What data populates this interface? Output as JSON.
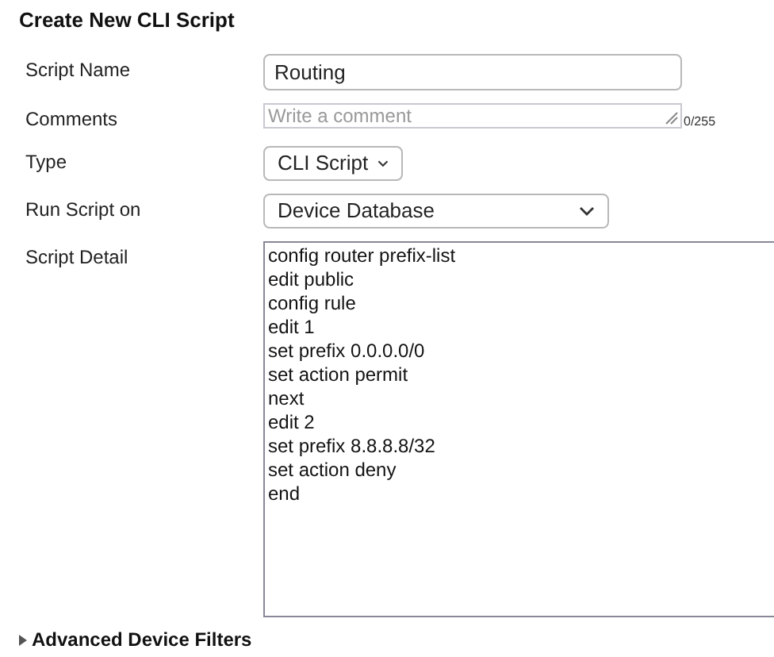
{
  "title": "Create New CLI Script",
  "fields": [
    {
      "kind": "text",
      "label": "Script Name",
      "value": "Routing"
    },
    {
      "kind": "comment",
      "label": "Comments",
      "placeholder": "Write a comment",
      "counter": "0/255"
    },
    {
      "kind": "select-short",
      "label": "Type",
      "value": "CLI Script"
    },
    {
      "kind": "select-wide",
      "label": "Run Script on",
      "value": "Device Database"
    },
    {
      "kind": "script",
      "label": "Script Detail",
      "lines": [
        "config router prefix-list",
        "edit public",
        "config rule",
        "edit 1",
        "set prefix 0.0.0.0/0",
        "set action permit",
        "next",
        "edit 2",
        "set prefix 8.8.8.8/32",
        "set action deny",
        "end"
      ]
    }
  ],
  "advanced": {
    "label": "Advanced Device Filters",
    "expanded": false
  }
}
